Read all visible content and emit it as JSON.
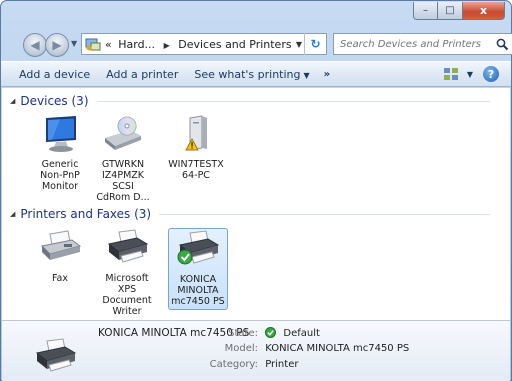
{
  "window": {
    "minimize": "–",
    "maximize": "□",
    "close": "x"
  },
  "nav": {
    "breadcrumb": [
      "«",
      "Hard...",
      "Devices and Printers"
    ],
    "search_placeholder": "Search Devices and Printers"
  },
  "toolbar": {
    "add_device": "Add a device",
    "add_printer": "Add a printer",
    "see_printing": "See what's printing",
    "more": "»"
  },
  "groups": {
    "devices": {
      "title": "Devices (3)",
      "items": [
        {
          "label": "Generic Non-PnP Monitor",
          "icon": "monitor-icon"
        },
        {
          "label": "GTWRKN IZ4PMZK SCSI CdRom D...",
          "icon": "cdrom-drive-icon"
        },
        {
          "label": "WIN7TESTX 64-PC",
          "icon": "computer-tower-warning-icon"
        }
      ]
    },
    "printers": {
      "title": "Printers and Faxes (3)",
      "items": [
        {
          "label": "Fax",
          "icon": "fax-icon"
        },
        {
          "label": "Microsoft XPS Document Writer",
          "icon": "printer-icon"
        },
        {
          "label": "KONICA MINOLTA mc7450 PS",
          "icon": "default-printer-icon",
          "selected": true
        }
      ]
    }
  },
  "details": {
    "name": "KONICA MINOLTA mc7450 PS",
    "state_label": "State:",
    "state_value": "Default",
    "model_label": "Model:",
    "model_value": "KONICA MINOLTA mc7450 PS",
    "category_label": "Category:",
    "category_value": "Printer"
  }
}
